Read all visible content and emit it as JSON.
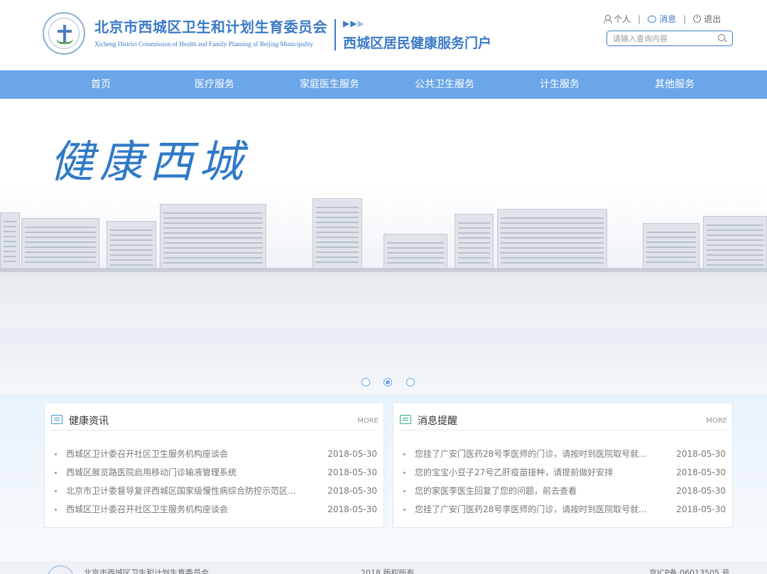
{
  "header": {
    "org_name_cn": "北京市西城区卫生和计划生育委员会",
    "org_name_en": "Xicheng District Commission of Health and Family Planning of Beijing Municipality",
    "arrows": "▶▶",
    "arrow3": "▶",
    "portal_title": "西城区居民健康服务门户",
    "links": {
      "personal": "个人",
      "messages": "消息",
      "logout": "退出"
    },
    "separator": "|",
    "search_placeholder": "请输入查询内容"
  },
  "nav": {
    "items": [
      "首页",
      "医疗服务",
      "家庭医生服务",
      "公共卫生服务",
      "计生服务",
      "其他服务"
    ]
  },
  "banner": {
    "slogan": "健康西城",
    "carousel": {
      "count": 3,
      "active": 2
    }
  },
  "news_panel": {
    "title": "健康资讯",
    "more": "MORE",
    "items": [
      {
        "text": "西城区卫计委召开社区卫生服务机构座谈会",
        "date": "2018-05-30"
      },
      {
        "text": "西城区展览路医院启用移动门诊输液管理系统",
        "date": "2018-05-30"
      },
      {
        "text": "北京市卫计委督导复评西城区国家级慢性病综合防控示范区...",
        "date": "2018-05-30"
      },
      {
        "text": "西城区卫计委召开社区卫生服务机构座谈会",
        "date": "2018-05-30"
      }
    ]
  },
  "msg_panel": {
    "title": "消息提醒",
    "more": "MORE",
    "items": [
      {
        "text": "您挂了广安门医药28号李医师的门诊，请按时到医院取号就...",
        "date": "2018-05-30"
      },
      {
        "text": "您的宝宝小豆子27号乙肝疫苗接种，请提前做好安排",
        "date": "2018-05-30"
      },
      {
        "text": "您的家医李医生回复了您的问题，前去查看",
        "date": "2018-05-30"
      },
      {
        "text": "您挂了广安门医药28号李医师的门诊，请按时到医院取号就...",
        "date": "2018-05-30"
      }
    ]
  },
  "footer": {
    "org": "北京市西城区卫生和计划生育委员会",
    "copyright": "2018 版权所有",
    "icp": "京ICP备 06013505 号"
  },
  "colors": {
    "primary": "#3b7ac8",
    "nav_bg": "#6aa6e8",
    "slogan": "#2f7ac8"
  }
}
